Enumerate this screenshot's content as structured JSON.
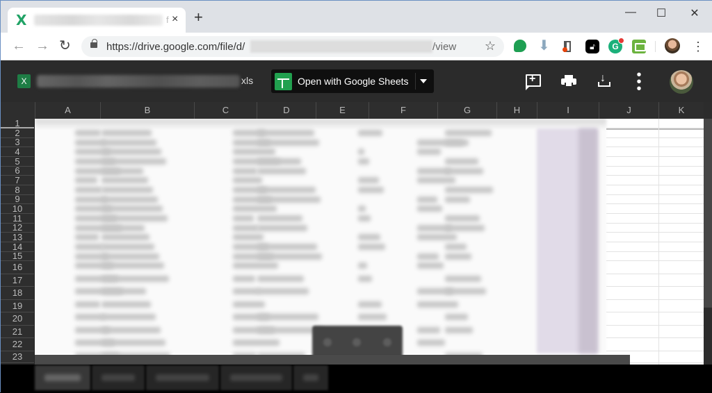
{
  "browser": {
    "tab": {
      "favicon": "excel-icon",
      "title_visible_tail": "f",
      "close_label": "×"
    },
    "new_tab_label": "+",
    "window_controls": {
      "minimize": "—",
      "maximize": "☐",
      "close": "✕"
    },
    "nav": {
      "back": "←",
      "forward": "→",
      "reload": "↻"
    },
    "address": {
      "url_prefix": "https://drive.google.com/file/d/",
      "url_suffix": "/view",
      "bookmark_icon": "☆"
    },
    "extensions": [
      "hangouts-icon",
      "download-arrow-icon",
      "office-icon",
      "lock-extension-icon",
      "grammarly-icon",
      "print-friendly-icon"
    ],
    "menu_icon": "⋮"
  },
  "viewer": {
    "file_icon_label": "X",
    "file_name_visible_tail": "xls",
    "open_with_label": "Open with Google Sheets",
    "actions": [
      "add-comment-icon",
      "print-icon",
      "download-icon",
      "more-options-icon"
    ],
    "more_label": "⋮"
  },
  "sheet": {
    "columns": [
      "A",
      "B",
      "C",
      "D",
      "E",
      "F",
      "G",
      "H",
      "I",
      "J",
      "K"
    ],
    "rows": [
      "1",
      "2",
      "3",
      "4",
      "5",
      "6",
      "7",
      "8",
      "9",
      "10",
      "11",
      "12",
      "13",
      "14",
      "15",
      "16",
      "17",
      "18",
      "19",
      "20",
      "21",
      "22",
      "23"
    ],
    "tabs_count": 5,
    "highlight_color": "#e1dbe8"
  }
}
